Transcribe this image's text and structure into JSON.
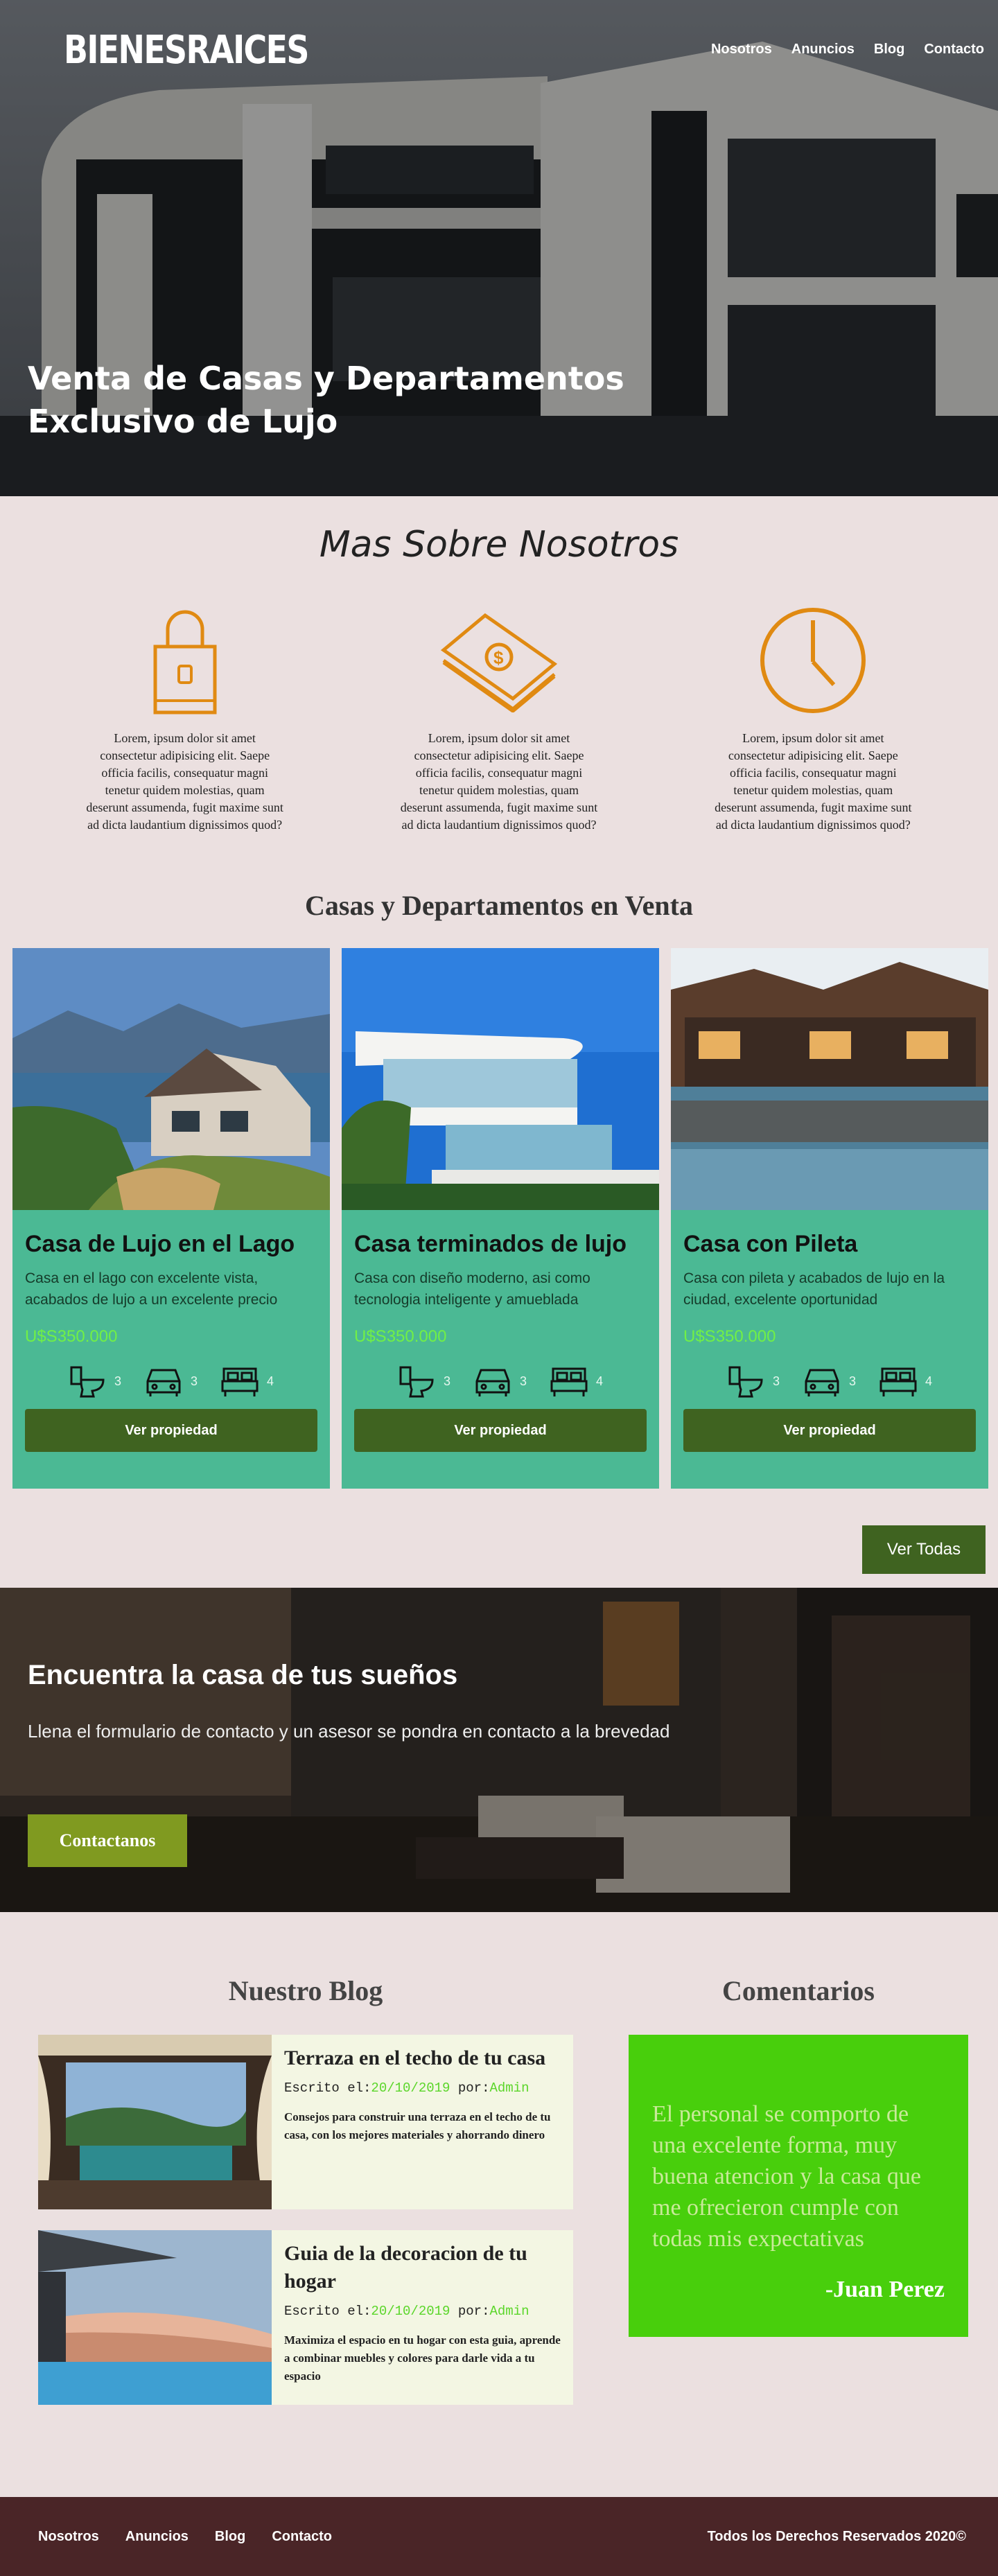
{
  "header": {
    "logo": "BIENESRAICES",
    "nav": [
      "Nosotros",
      "Anuncios",
      "Blog",
      "Contacto"
    ],
    "hero_title_line1": "Venta de Casas y Departamentos",
    "hero_title_line2": "Exclusivo de Lujo"
  },
  "about": {
    "title": "Mas Sobre Nosotros",
    "features": [
      {
        "icon": "lock-icon",
        "text": "Lorem, ipsum dolor sit amet consectetur adipisicing elit. Saepe officia facilis, consequatur magni tenetur quidem molestias, quam deserunt assumenda, fugit maxime sunt ad dicta laudantium dignissimos quod?"
      },
      {
        "icon": "money-icon",
        "text": "Lorem, ipsum dolor sit amet consectetur adipisicing elit. Saepe officia facilis, consequatur magni tenetur quidem molestias, quam deserunt assumenda, fugit maxime sunt ad dicta laudantium dignissimos quod?"
      },
      {
        "icon": "clock-icon",
        "text": "Lorem, ipsum dolor sit amet consectetur adipisicing elit. Saepe officia facilis, consequatur magni tenetur quidem molestias, quam deserunt assumenda, fugit maxime sunt ad dicta laudantium dignissimos quod?"
      }
    ]
  },
  "listings": {
    "title": "Casas y Departamentos en Venta",
    "cards": [
      {
        "title": "Casa de Lujo en el Lago",
        "desc": "Casa en el lago con excelente vista, acabados de lujo a un excelente precio",
        "price": "U$S350.000",
        "baths": "3",
        "parking": "3",
        "rooms": "4",
        "button": "Ver propiedad"
      },
      {
        "title": "Casa terminados de lujo",
        "desc": "Casa con diseño moderno, asi como tecnologia inteligente y amueblada",
        "price": "U$S350.000",
        "baths": "3",
        "parking": "3",
        "rooms": "4",
        "button": "Ver propiedad"
      },
      {
        "title": "Casa con Pileta",
        "desc": "Casa con pileta y acabados de lujo en la ciudad, excelente oportunidad",
        "price": "U$S350.000",
        "baths": "3",
        "parking": "3",
        "rooms": "4",
        "button": "Ver propiedad"
      }
    ],
    "view_all": "Ver Todas"
  },
  "cta": {
    "title": "Encuentra la casa de tus sueños",
    "text": "Llena el formulario de contacto y un asesor se pondra en contacto a la brevedad",
    "button": "Contactanos"
  },
  "blog": {
    "title": "Nuestro Blog",
    "written_label": "Escrito el:",
    "by_label": "por:",
    "posts": [
      {
        "title": "Terraza en el techo de tu casa",
        "date": "20/10/2019",
        "author": "Admin",
        "excerpt": "Consejos para construir una terraza en el techo de tu casa, con los mejores materiales y ahorrando dinero"
      },
      {
        "title": "Guia de la decoracion de tu hogar",
        "date": "20/10/2019",
        "author": "Admin",
        "excerpt": "Maximiza el espacio en tu hogar con esta guia, aprende a combinar muebles y colores para darle vida a tu espacio"
      }
    ]
  },
  "comments": {
    "title": "Comentarios",
    "quote": "El personal se comporto de una excelente forma, muy buena atencion y la casa que me ofrecieron cumple con todas mis expectativas",
    "author": "-Juan Perez"
  },
  "footer": {
    "nav": [
      "Nosotros",
      "Anuncios",
      "Blog",
      "Contacto"
    ],
    "copyright": "Todos los Derechos Reservados 2020©"
  },
  "colors": {
    "accent_orange": "#e08a12",
    "card_green": "#4bb994",
    "button_green": "#3f6320",
    "price_green": "#71f046",
    "quote_green": "#48cf0c",
    "footer": "#4a2527"
  }
}
